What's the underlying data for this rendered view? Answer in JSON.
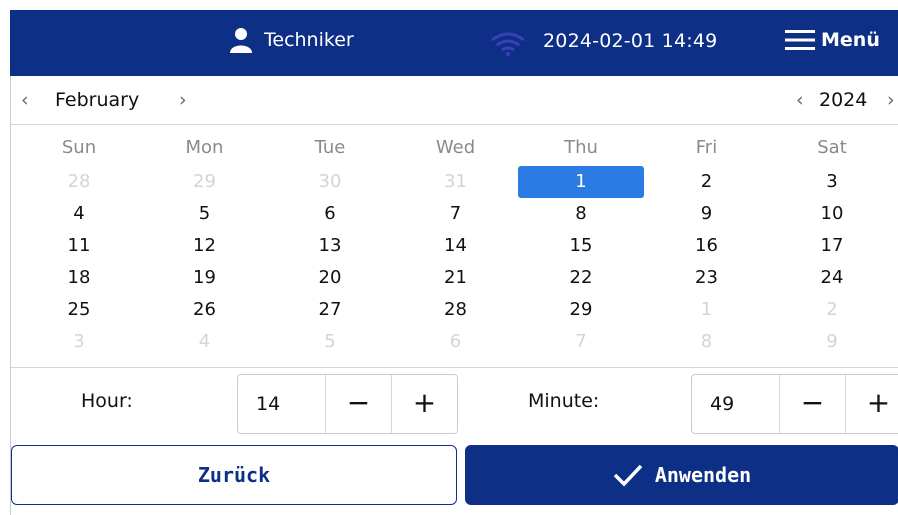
{
  "header": {
    "user_label": "Techniker",
    "datetime": "2024-02-01  14:49",
    "menu_label": "Menü",
    "icons": [
      "user-icon",
      "wifi-icon",
      "hamburger-menu-icon"
    ]
  },
  "calendar": {
    "month": "February",
    "year": "2024",
    "prev_arrow": "‹",
    "next_arrow": "›",
    "weekdays": [
      "Sun",
      "Mon",
      "Tue",
      "Wed",
      "Thu",
      "Fri",
      "Sat"
    ],
    "weeks": [
      [
        "28",
        "29",
        "30",
        "31",
        "1",
        "2",
        "3"
      ],
      [
        "4",
        "5",
        "6",
        "7",
        "8",
        "9",
        "10"
      ],
      [
        "11",
        "12",
        "13",
        "14",
        "15",
        "16",
        "17"
      ],
      [
        "18",
        "19",
        "20",
        "21",
        "22",
        "23",
        "24"
      ],
      [
        "25",
        "26",
        "27",
        "28",
        "29",
        "1",
        "2"
      ],
      [
        "3",
        "4",
        "5",
        "6",
        "7",
        "8",
        "9"
      ]
    ],
    "selected_day": "1"
  },
  "time": {
    "hour_label": "Hour:",
    "hour_value": "14",
    "minute_label": "Minute:",
    "minute_value": "49",
    "minus": "−",
    "plus": "+"
  },
  "footer": {
    "back_label": "Zurück",
    "apply_label": "Anwenden"
  },
  "colors": {
    "primary": "#0d2f86",
    "selected": "#2c7be5",
    "muted_day": "#d2d4d8"
  }
}
